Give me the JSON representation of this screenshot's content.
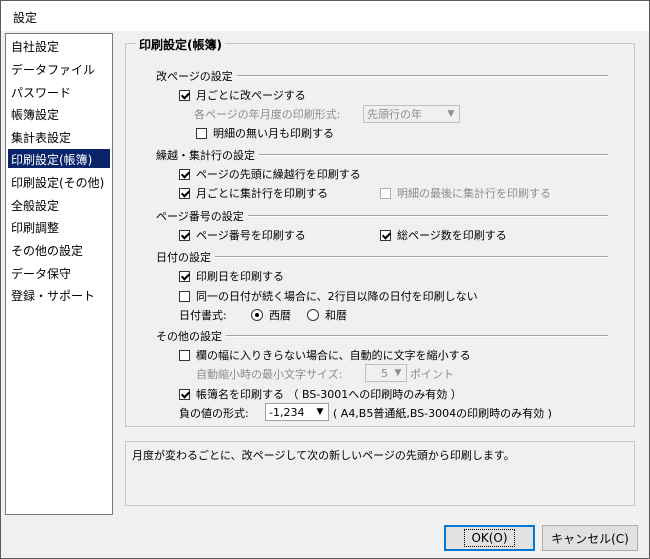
{
  "window": {
    "title": "設定"
  },
  "sidebar": {
    "items": [
      "自社設定",
      "データファイル",
      "パスワード",
      "帳簿設定",
      "集計表設定",
      "印刷設定(帳簿)",
      "印刷設定(その他)",
      "全般設定",
      "印刷調整",
      "その他の設定",
      "データ保守",
      "登録・サポート"
    ],
    "selected": "印刷設定(帳簿)"
  },
  "main": {
    "title": "印刷設定(帳簿)",
    "page_break": {
      "title": "改ページの設定",
      "monthly_break": "月ごとに改ページする",
      "year_print_label": "各ページの年月度の印刷形式:",
      "year_print_value": "先頭行の年",
      "print_empty_months": "明細の無い月も印刷する"
    },
    "carry": {
      "title": "繰越・集計行の設定",
      "carry_at_top": "ページの先頭に繰越行を印刷する",
      "monthly_total": "月ごとに集計行を印刷する",
      "total_at_last": "明細の最後に集計行を印刷する"
    },
    "page_number": {
      "title": "ページ番号の設定",
      "print_page_number": "ページ番号を印刷する",
      "print_total_pages": "総ページ数を印刷する"
    },
    "date": {
      "title": "日付の設定",
      "print_date": "印刷日を印刷する",
      "same_date": "同一の日付が続く場合に、2行目以降の日付を印刷しない",
      "format_label": "日付書式:",
      "western": "西暦",
      "japanese": "和暦"
    },
    "other": {
      "title": "その他の設定",
      "shrink_text": "欄の幅に入りきらない場合に、自動的に文字を縮小する",
      "min_size_label": "自動縮小時の最小文字サイズ:",
      "min_size_value": "5",
      "point": "ポイント",
      "print_book_name": "帳簿名を印刷する （ BS-3001への印刷時のみ有効 ）",
      "negative_label": "負の値の形式:",
      "negative_value": "-1,234",
      "negative_note": "( A4,B5普通紙,BS-3004の印刷時のみ有効 )"
    }
  },
  "description": "月度が変わるごとに、改ページして次の新しいページの先頭から印刷します。",
  "buttons": {
    "ok": "OK(O)",
    "cancel": "キャンセル(C)"
  }
}
